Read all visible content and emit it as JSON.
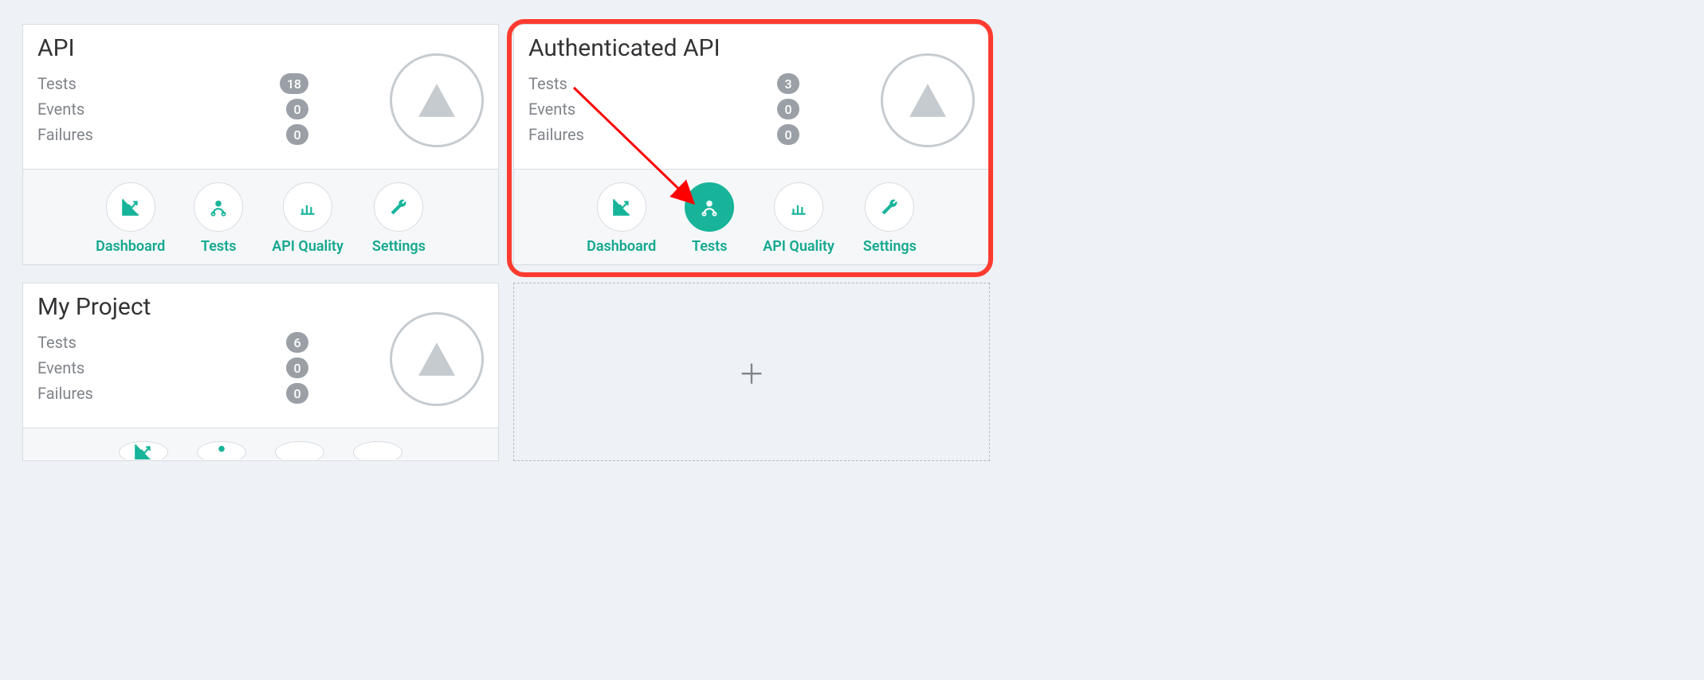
{
  "labels": {
    "tests": "Tests",
    "events": "Events",
    "failures": "Failures"
  },
  "footer": {
    "dashboard": "Dashboard",
    "tests": "Tests",
    "api_quality": "API Quality",
    "settings": "Settings"
  },
  "cards": [
    {
      "title": "API",
      "tests": "18",
      "events": "0",
      "failures": "0"
    },
    {
      "title": "Authenticated API",
      "tests": "3",
      "events": "0",
      "failures": "0"
    },
    {
      "title": "My Project",
      "tests": "6",
      "events": "0",
      "failures": "0"
    }
  ],
  "colors": {
    "accent": "#17b49a",
    "highlight": "#ff3b30"
  }
}
